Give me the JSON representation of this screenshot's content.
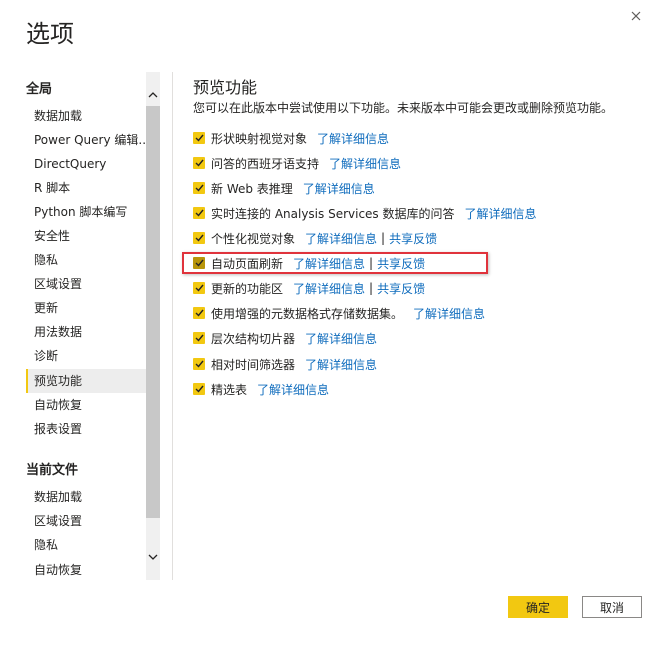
{
  "dialog": {
    "title": "选项"
  },
  "sidebar": {
    "global_header": "全局",
    "global_items": [
      {
        "label": "数据加载"
      },
      {
        "label": "Power Query 编辑..."
      },
      {
        "label": "DirectQuery"
      },
      {
        "label": "R 脚本"
      },
      {
        "label": "Python 脚本编写"
      },
      {
        "label": "安全性"
      },
      {
        "label": "隐私"
      },
      {
        "label": "区域设置"
      },
      {
        "label": "更新"
      },
      {
        "label": "用法数据"
      },
      {
        "label": "诊断"
      },
      {
        "label": "预览功能",
        "active": true
      },
      {
        "label": "自动恢复"
      },
      {
        "label": "报表设置"
      }
    ],
    "file_header": "当前文件",
    "file_items": [
      {
        "label": "数据加载"
      },
      {
        "label": "区域设置"
      },
      {
        "label": "隐私"
      },
      {
        "label": "自动恢复"
      }
    ]
  },
  "main": {
    "title": "预览功能",
    "description": "您可以在此版本中尝试使用以下功能。未来版本中可能会更改或删除预览功能。",
    "link_label": "了解详细信息",
    "feedback_label": "共享反馈",
    "features": [
      {
        "label": "形状映射视觉对象",
        "checked": true
      },
      {
        "label": "问答的西班牙语支持",
        "checked": true
      },
      {
        "label": "新 Web 表推理",
        "checked": true
      },
      {
        "label": "实时连接的 Analysis Services 数据库的问答",
        "checked": true
      },
      {
        "label": "个性化视觉对象",
        "checked": true,
        "feedback": true
      },
      {
        "label": "自动页面刷新",
        "checked": true,
        "feedback": true,
        "highlighted": true
      },
      {
        "label": "更新的功能区",
        "checked": true,
        "feedback": true
      },
      {
        "label": "使用增强的元数据格式存储数据集。",
        "checked": true
      },
      {
        "label": "层次结构切片器",
        "checked": true
      },
      {
        "label": "相对时间筛选器",
        "checked": true
      },
      {
        "label": "精选表",
        "checked": true
      }
    ]
  },
  "buttons": {
    "ok": "确定",
    "cancel": "取消"
  },
  "colors": {
    "accent": "#f2c811",
    "link": "#0f6cbd",
    "highlight_border": "#e0333c"
  },
  "icons": {
    "close": "close-icon",
    "scroll_up": "chevron-up-icon",
    "scroll_down": "chevron-down-icon",
    "check": "checkmark-icon"
  }
}
